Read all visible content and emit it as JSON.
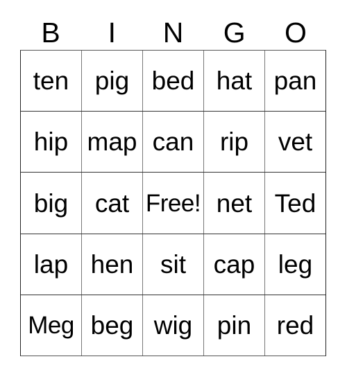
{
  "card": {
    "title": "BINGO",
    "header_letters": [
      "B",
      "I",
      "N",
      "G",
      "O"
    ],
    "free_space_label": "Free!",
    "colors": {
      "background": "#ffffff",
      "text": "#000000",
      "grid_line": "#555555"
    },
    "rows": [
      [
        "ten",
        "pig",
        "bed",
        "hat",
        "pan"
      ],
      [
        "hip",
        "map",
        "can",
        "rip",
        "vet"
      ],
      [
        "big",
        "cat",
        "Free!",
        "net",
        "Ted"
      ],
      [
        "lap",
        "hen",
        "sit",
        "cap",
        "leg"
      ],
      [
        "Meg",
        "beg",
        "wig",
        "pin",
        "red"
      ]
    ]
  }
}
